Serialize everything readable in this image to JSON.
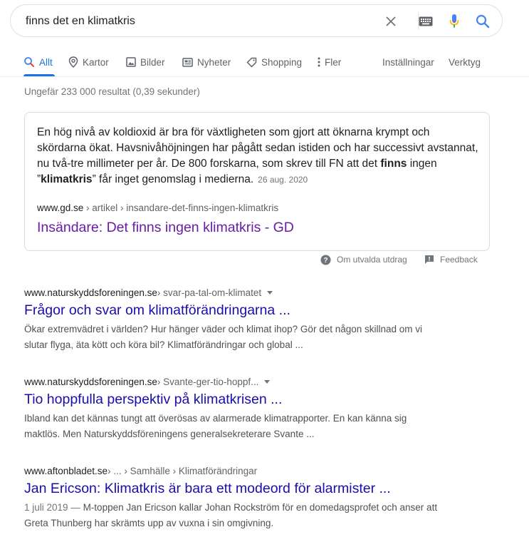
{
  "search": {
    "query": "finns det en klimatkris",
    "clear_icon": "close-icon",
    "keyboard_icon": "keyboard-icon",
    "mic_icon": "mic-icon",
    "search_icon": "search-icon"
  },
  "tabs": [
    {
      "label": "Allt",
      "icon": "search-icon"
    },
    {
      "label": "Kartor",
      "icon": "map-pin-icon"
    },
    {
      "label": "Bilder",
      "icon": "image-icon"
    },
    {
      "label": "Nyheter",
      "icon": "news-icon"
    },
    {
      "label": "Shopping",
      "icon": "tag-icon"
    },
    {
      "label": "Fler",
      "icon": "more-vert-icon"
    }
  ],
  "tools": {
    "settings": "Inställningar",
    "tools": "Verktyg"
  },
  "result_stats": "Ungefär 233 000 resultat (0,39 sekunder)",
  "featured_snippet": {
    "text_1": "En hög nivå av koldioxid är bra för växtligheten som gjort att öknarna krympt och skördarna ökat. Havsnivåhöjningen har pågått sedan istiden och har successivt avstannat, nu två-tre millimeter per år. De 800 forskarna, som skrev till FN att det ",
    "bold_1": "finns",
    "text_2": " ingen ”",
    "bold_2": "klimatkris",
    "text_3": "” får inget genomslag i medierna.",
    "date": "26 aug. 2020",
    "domain": "www.gd.se",
    "path": " › artikel › insandare-det-finns-ingen-klimatkris",
    "title": "Insändare: Det finns ingen klimatkris - GD",
    "about_label": "Om utvalda utdrag",
    "feedback_label": "Feedback"
  },
  "results": [
    {
      "domain": "www.naturskyddsforeningen.se",
      "path": " › svar-pa-tal-om-klimatet",
      "title": "Frågor och svar om klimatförändringarna ...",
      "date": "",
      "snippet": "Ökar extremvädret i världen? Hur hänger väder och klimat ihop? Gör det någon skillnad om vi slutar flyga, äta kött och köra bil? Klimatförändringar och global ..."
    },
    {
      "domain": "www.naturskyddsforeningen.se",
      "path": " › Svante-ger-tio-hoppf...",
      "title": "Tio hoppfulla perspektiv på klimatkrisen ...",
      "date": "",
      "snippet": "Ibland kan det kännas tungt att överösas av alarmerade klimatrapporter. En kan känna sig maktlös. Men Naturskyddsföreningens generalsekreterare Svante ..."
    },
    {
      "domain": "www.aftonbladet.se",
      "path": " › ... › Samhälle › Klimatförändringar",
      "title": "Jan Ericson: Klimatkris är bara ett modeord för alarmister ...",
      "date": "1 juli 2019 — ",
      "snippet": "M-toppen Jan Ericson kallar Johan Rockström för en domedagsprofet och anser att Greta Thunberg har skrämts upp av vuxna i sin omgivning."
    }
  ],
  "colors": {
    "accent": "#1a73e8",
    "link": "#1a0dab",
    "visited": "#681da8"
  }
}
